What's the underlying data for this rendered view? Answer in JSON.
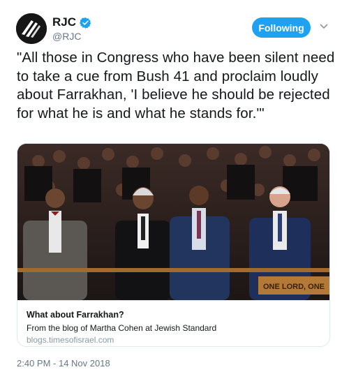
{
  "account": {
    "name": "RJC",
    "handle": "@RJC",
    "verified": true
  },
  "follow_button": {
    "label": "Following"
  },
  "tweet": {
    "text": "\"All those in Congress who have been silent need to take a cue from Bush 41 and proclaim loudly about Farrakhan, 'I believe he should be rejected for what he is and what he stands for.'\""
  },
  "card": {
    "photo_sign_text": "ONE LORD, ONE",
    "title": "What about Farrakhan?",
    "description": "From the blog of Martha Cohen at Jewish Standard",
    "domain": "blogs.timesofisrael.com"
  },
  "timestamp": "2:40 PM - 14 Nov 2018",
  "colors": {
    "accent": "#1da1f2",
    "text": "#14171a",
    "muted": "#657786"
  }
}
